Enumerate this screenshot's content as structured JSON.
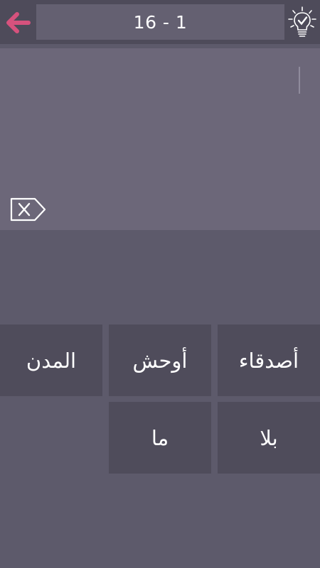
{
  "header": {
    "back_icon": "left-arrow-icon",
    "level_label": "16 - 1",
    "hint_icon": "lightbulb-check-icon"
  },
  "answer": {
    "current_text": "",
    "delete_icon": "backspace-x-icon"
  },
  "words": [
    {
      "label": "أصدقاء"
    },
    {
      "label": "أوحش"
    },
    {
      "label": "المدن"
    },
    {
      "label": "بلا"
    },
    {
      "label": "ما"
    }
  ],
  "colors": {
    "background": "#5d5a6b",
    "topbar": "#4e4b5a",
    "level_box": "#646071",
    "answer_area": "#6c6779",
    "tile": "#4f4c5b",
    "accent_back_arrow": "#d6527d",
    "text": "#ffffff"
  }
}
